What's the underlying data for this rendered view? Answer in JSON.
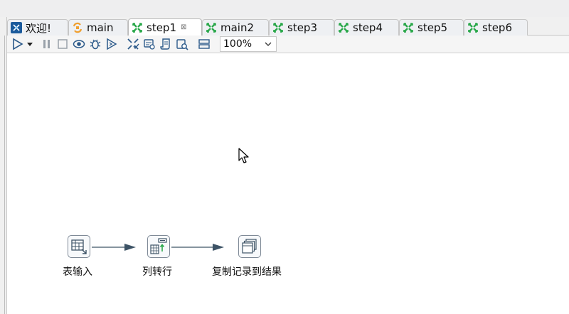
{
  "tabs": [
    {
      "label": "欢迎!",
      "icon": "welcome-icon",
      "active": false
    },
    {
      "label": "main",
      "icon": "job-icon",
      "active": false
    },
    {
      "label": "step1",
      "icon": "transformation-icon",
      "active": true,
      "close": "⊠"
    },
    {
      "label": "main2",
      "icon": "transformation-icon",
      "active": false
    },
    {
      "label": "step3",
      "icon": "transformation-icon",
      "active": false
    },
    {
      "label": "step4",
      "icon": "transformation-icon",
      "active": false
    },
    {
      "label": "step5",
      "icon": "transformation-icon",
      "active": false
    },
    {
      "label": "step6",
      "icon": "transformation-icon",
      "active": false
    }
  ],
  "toolbar": {
    "zoom": "100%",
    "buttons": [
      "run-icon",
      "run-dropdown-icon",
      "pause-icon",
      "stop-icon",
      "preview-icon",
      "debug-icon",
      "replay-icon",
      "verify-icon",
      "impact-icon",
      "sql-icon",
      "explore-db-icon",
      "show-results-icon"
    ]
  },
  "steps": [
    {
      "label": "表输入",
      "icon": "table-input-icon"
    },
    {
      "label": "列转行",
      "icon": "row-denormaliser-icon"
    },
    {
      "label": "复制记录到结果",
      "icon": "copy-rows-to-result-icon"
    }
  ],
  "colors": {
    "transformation_icon": "#2aa84a",
    "job_icon": "#f0a030",
    "hop_arrow": "#3d5366"
  }
}
